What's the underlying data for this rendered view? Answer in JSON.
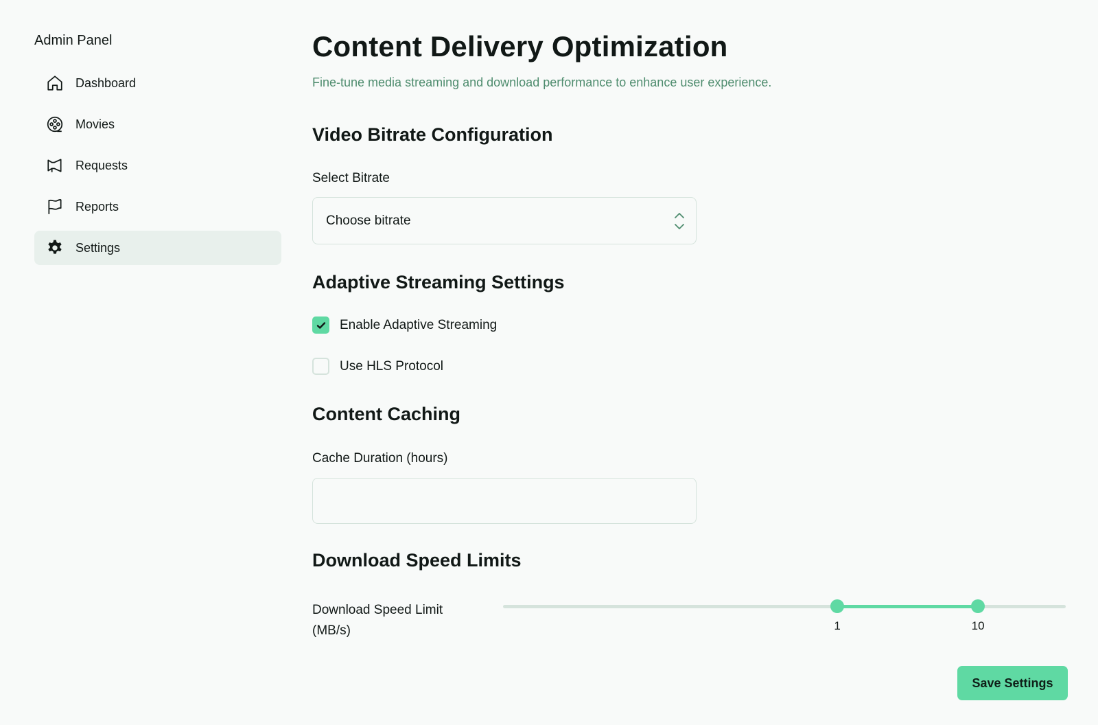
{
  "sidebar": {
    "title": "Admin Panel",
    "items": [
      {
        "label": "Dashboard",
        "icon": "home-icon"
      },
      {
        "label": "Movies",
        "icon": "film-reel-icon"
      },
      {
        "label": "Requests",
        "icon": "megaphone-icon"
      },
      {
        "label": "Reports",
        "icon": "flag-icon"
      },
      {
        "label": "Settings",
        "icon": "gear-icon",
        "active": true
      }
    ]
  },
  "main": {
    "title": "Content Delivery Optimization",
    "subtitle": "Fine-tune media streaming and download performance to enhance user experience.",
    "bitrate_section": {
      "title": "Video Bitrate Configuration",
      "label": "Select Bitrate",
      "selected": "Choose bitrate"
    },
    "adaptive_section": {
      "title": "Adaptive Streaming Settings",
      "options": [
        {
          "label": "Enable Adaptive Streaming",
          "checked": true
        },
        {
          "label": "Use HLS Protocol",
          "checked": false
        }
      ]
    },
    "caching_section": {
      "title": "Content Caching",
      "label": "Cache Duration (hours)",
      "value": ""
    },
    "speed_section": {
      "title": "Download Speed Limits",
      "label": "Download Speed Limit (MB/s)",
      "min_value": "1",
      "max_value": "10",
      "range_min_fraction": 0.594,
      "range_max_fraction": 0.844
    },
    "save_label": "Save Settings"
  },
  "colors": {
    "accent": "#5fd9a3",
    "subtitle": "#4e8c6e",
    "active_nav_bg": "#e8f0ec",
    "border": "#d5e3dc"
  }
}
